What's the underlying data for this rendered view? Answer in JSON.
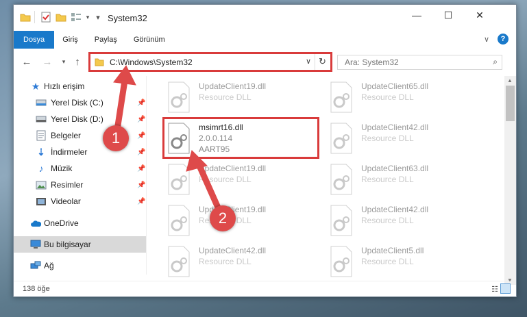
{
  "window": {
    "title": "System32",
    "controls": {
      "minimize": "—",
      "maximize": "☐",
      "close": "✕"
    }
  },
  "ribbon": {
    "tabs": [
      "Dosya",
      "Giriş",
      "Paylaş",
      "Görünüm"
    ]
  },
  "address": {
    "path": "C:\\Windows\\System32",
    "search_placeholder": "Ara: System32"
  },
  "nav": {
    "items": [
      {
        "label": "Hızlı erişim",
        "icon": "star-icon",
        "pinned": false
      },
      {
        "label": "Yerel Disk (C:)",
        "icon": "drive-icon",
        "pinned": true
      },
      {
        "label": "Yerel Disk (D:)",
        "icon": "drive-icon",
        "pinned": true
      },
      {
        "label": "Belgeler",
        "icon": "documents-icon",
        "pinned": true
      },
      {
        "label": "İndirmeler",
        "icon": "download-icon",
        "pinned": true
      },
      {
        "label": "Müzik",
        "icon": "music-icon",
        "pinned": true
      },
      {
        "label": "Resimler",
        "icon": "pictures-icon",
        "pinned": true
      },
      {
        "label": "Videolar",
        "icon": "videos-icon",
        "pinned": true
      },
      {
        "label": "OneDrive",
        "icon": "cloud-icon",
        "pinned": false
      },
      {
        "label": "Bu bilgisayar",
        "icon": "computer-icon",
        "pinned": false,
        "selected": true
      },
      {
        "label": "Ağ",
        "icon": "network-icon",
        "pinned": false
      }
    ]
  },
  "files": {
    "left": [
      {
        "name": "UpdateClient19.dll",
        "desc": "Resource DLL"
      },
      {
        "name": "msimrt16.dll",
        "desc": "2.0.0.114",
        "extra": "AART95",
        "highlighted": true
      },
      {
        "name": "UpdateClient19.dll",
        "desc": "Resource DLL"
      },
      {
        "name": "UpdateClient19.dll",
        "desc": "Resource DLL"
      },
      {
        "name": "UpdateClient42.dll",
        "desc": "Resource DLL"
      }
    ],
    "right": [
      {
        "name": "UpdateClient65.dll",
        "desc": "Resource DLL"
      },
      {
        "name": "UpdateClient42.dll",
        "desc": "Resource DLL"
      },
      {
        "name": "UpdateClient63.dll",
        "desc": "Resource DLL"
      },
      {
        "name": "UpdateClient42.dll",
        "desc": "Resource DLL"
      },
      {
        "name": "UpdateClient5.dll",
        "desc": "Resource DLL"
      }
    ]
  },
  "status": {
    "count": "138 öğe"
  },
  "annotations": {
    "step1": "1",
    "step2": "2",
    "color": "#de4a4a"
  }
}
